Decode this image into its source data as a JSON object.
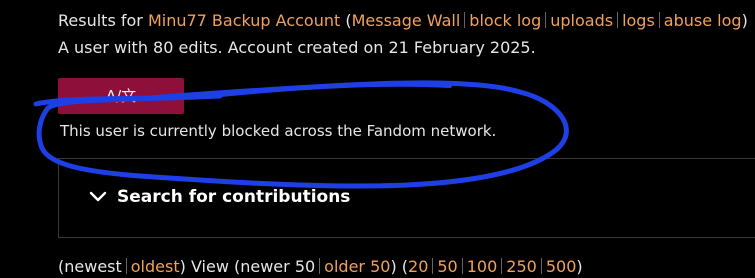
{
  "header": {
    "prefix": "Results for ",
    "username": "Minu77 Backup Account",
    "open_paren": " (",
    "links": [
      "Message Wall",
      "block log",
      "uploads",
      "logs",
      "abuse log"
    ],
    "close_paren": ")"
  },
  "info_line": "A user with 80 edits. Account created on 21 February 2025.",
  "language_button": "A/文",
  "blocked_notice": "This user is currently blocked across the Fandom network.",
  "search": {
    "label": "Search for contributions"
  },
  "pagination": {
    "newest": "(newest",
    "oldest": "oldest",
    "view_text": ") View (newer 50",
    "older_50": "older 50",
    "paren_close_open": ") (",
    "counts": [
      "20",
      "50",
      "100",
      "250",
      "500"
    ],
    "close": ")"
  },
  "colors": {
    "link": "#f0a15a",
    "background": "#000000",
    "button": "#8d0f3a",
    "annotation": "#1f3fe6"
  }
}
